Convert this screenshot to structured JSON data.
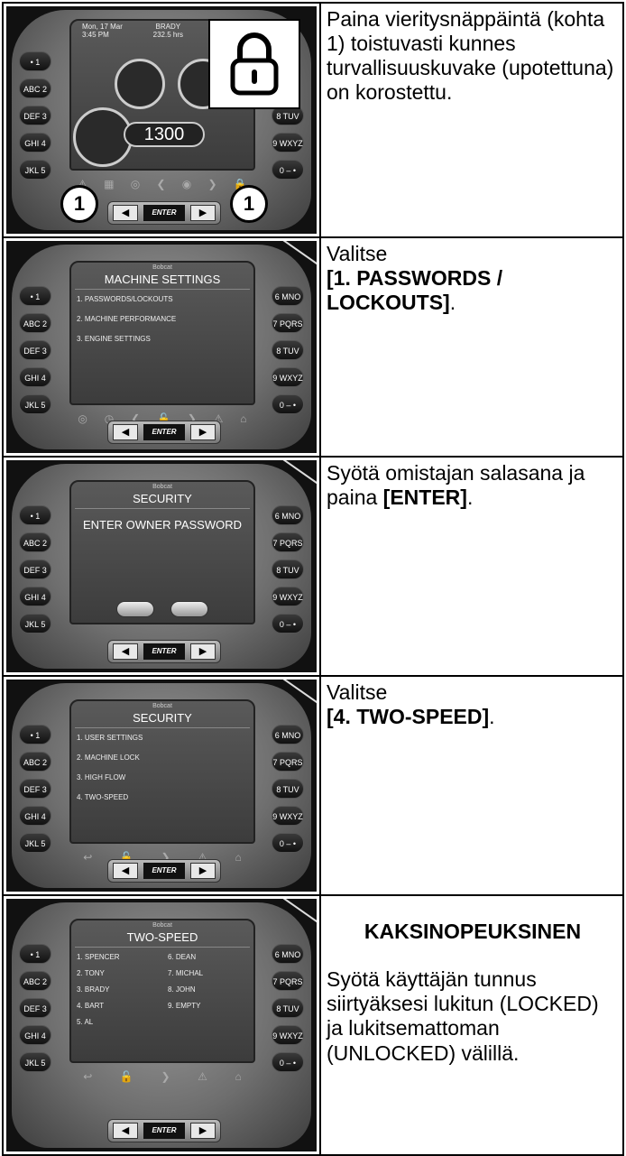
{
  "keys_left": [
    "• 1",
    "ABC 2",
    "DEF 3",
    "GHI 4",
    "JKL 5"
  ],
  "keys_right_row1": [
    "8 TUV",
    "9 WXYZ",
    "0 – •"
  ],
  "keys_right": [
    "6 MNO",
    "7 PQRS",
    "8 TUV",
    "9 WXYZ",
    "0 – •"
  ],
  "nav": {
    "left": "◀",
    "enter": "ENTER",
    "right": "▶"
  },
  "brand": "Bobcat",
  "steps": [
    {
      "screen": {
        "date": "Mon, 17 Mar",
        "time": "3:45 PM",
        "operator": "BRADY",
        "hours": "232.5 hrs",
        "rpm": "1300",
        "callout_left": "1",
        "callout_right": "1"
      },
      "text": "Paina vieritysnäppäintä (kohta 1) toistuvasti kunnes turvallisuuskuvake (upotettuna) on korostettu."
    },
    {
      "screen": {
        "title": "MACHINE SETTINGS",
        "items": [
          "1. PASSWORDS/LOCKOUTS",
          "2. MACHINE PERFORMANCE",
          "3. ENGINE SETTINGS"
        ]
      },
      "text_prefix": "Valitse",
      "text_bold": "[1. PASSWORDS / LOCKOUTS]",
      "text_suffix": "."
    },
    {
      "screen": {
        "title": "SECURITY",
        "prompt": "ENTER OWNER PASSWORD"
      },
      "text_prefix": "Syötä omistajan salasana ja paina ",
      "text_bold": "[ENTER]",
      "text_suffix": "."
    },
    {
      "screen": {
        "title": "SECURITY",
        "items": [
          "1. USER SETTINGS",
          "2. MACHINE LOCK",
          "3. HIGH FLOW",
          "4. TWO-SPEED"
        ]
      },
      "text_prefix": "Valitse",
      "text_bold": "[4. TWO-SPEED]",
      "text_suffix": "."
    },
    {
      "screen": {
        "title": "TWO-SPEED",
        "users_left": [
          "1. SPENCER",
          "2. TONY",
          "3. BRADY",
          "4. BART",
          "5. AL"
        ],
        "users_right": [
          "6. DEAN",
          "7. MICHAL",
          "8. JOHN",
          "9. EMPTY"
        ]
      },
      "heading": "KAKSINOPEUKSINEN",
      "text": "Syötä käyttäjän tunnus siirtyäksesi lukitun (LOCKED) ja lukitsemattoman (UNLOCKED) välillä."
    }
  ]
}
